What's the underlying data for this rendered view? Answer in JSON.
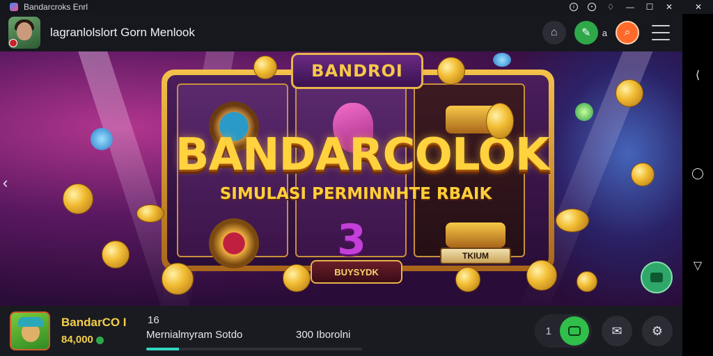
{
  "window": {
    "title": "Bandarcroks Enrl"
  },
  "header": {
    "title": "lagranlolslort Gorn Menlook",
    "action_label": "a"
  },
  "banner": {
    "top_plaque": "BANDROI",
    "headline": "BANDARCOLOK",
    "subtitle": "SIMULASI PERMINNHTE RBAIK",
    "cta_label": "BUYSYDK",
    "tag_label": "TKIUM",
    "reel_symbol_3": "3"
  },
  "bottom": {
    "game_name": "BandarCO I",
    "game_price": "84,000",
    "count": "16",
    "description": "Mernialmyram Sotdo",
    "stats": "300 Iborolni",
    "progress": 0.15,
    "comment_count": "1"
  },
  "colors": {
    "accent_gold": "#f7c948",
    "green": "#2fbf4a",
    "orange": "#ff6a2b",
    "teal_progress": "#33d4c0"
  },
  "icons": [
    "app-icon",
    "info-icon",
    "settings-icon",
    "notification-icon",
    "minimize-icon",
    "maximize-icon",
    "close-icon",
    "pin-icon",
    "home-icon",
    "search-icon",
    "menu-icon",
    "back-icon",
    "chevron-left-icon",
    "circle-home-icon",
    "recents-icon",
    "chat-icon",
    "comment-icon",
    "share-icon",
    "gear-icon"
  ]
}
